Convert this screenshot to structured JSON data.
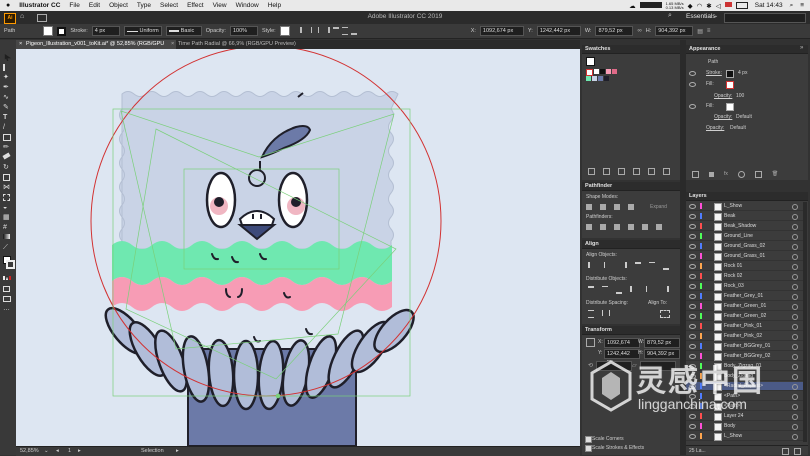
{
  "menubar": {
    "apple": "",
    "app_name": "Illustrator CC",
    "items": [
      "File",
      "Edit",
      "Object",
      "Type",
      "Select",
      "Effect",
      "View",
      "Window",
      "Help"
    ],
    "status_text": "1.65 MB/s\n0.13 MB/s",
    "clock": "Sat 14:43"
  },
  "appbar": {
    "window_title": "Adobe Illustrator CC 2019",
    "workspace": "Essentials"
  },
  "control": {
    "selection": "Path",
    "stroke_label": "Stroke:",
    "stroke_value": "4 px",
    "profile": "Uniform",
    "brush": "Basic",
    "opacity_label": "Opacity:",
    "opacity_value": "100%",
    "style_label": "Style:",
    "x_label": "X:",
    "x_value": "1092,674 px",
    "y_label": "Y:",
    "y_value": "1242,442 px",
    "w_label": "W:",
    "w_value": "879,52 px",
    "h_label": "H:",
    "h_value": "904,392 px"
  },
  "tabs": [
    {
      "label": "Pigeon_Illustration_v001_toKit.ai* @ 52,85% (RGB/GPU Preview)",
      "active": true
    },
    {
      "label": "Time Path Radial @ 66,9% (RGB/GPU Preview)",
      "active": false
    }
  ],
  "status": {
    "zoom": "52,85%",
    "page": "1",
    "mode": "Selection"
  },
  "swatches": {
    "title": "Swatches"
  },
  "appearance": {
    "title": "Appearance",
    "object": "Path",
    "rows": [
      {
        "label": "Stroke:",
        "value": "4 px"
      },
      {
        "label": "Fill:",
        "value": ""
      },
      {
        "label": "Opacity:",
        "value": "100"
      },
      {
        "label": "Fill:",
        "value": ""
      },
      {
        "label": "Opacity:",
        "value": "Default"
      },
      {
        "label": "Opacity:",
        "value": "Default"
      }
    ]
  },
  "pathfinder": {
    "title": "Pathfinder",
    "shape_modes": "Shape Modes:",
    "pathfinders": "Pathfinders:",
    "expand": "Expand"
  },
  "align": {
    "title": "Align",
    "align_objects": "Align Objects:",
    "distribute_objects": "Distribute Objects:",
    "distribute_spacing": "Distribute Spacing:",
    "align_to": "Align To:"
  },
  "transform": {
    "title": "Transform",
    "x_label": "X:",
    "x_value": "1092,674 px",
    "y_label": "Y:",
    "y_value": "1242,442 px",
    "w_label": "W:",
    "w_value": "879,52 px",
    "h_label": "H:",
    "h_value": "904,392 px",
    "scale_corners": "Scale Corners",
    "scale_strokes": "Scale Strokes & Effects"
  },
  "layers": {
    "title": "Layers",
    "rows": [
      {
        "name": "L_Show",
        "color": "#ff4fd8"
      },
      {
        "name": "Beak",
        "color": "#4f7dff"
      },
      {
        "name": "Beak_Shadow",
        "color": "#ff4f4f"
      },
      {
        "name": "Ground_Line",
        "color": "#4fff5a"
      },
      {
        "name": "Ground_Grass_02",
        "color": "#4f7dff"
      },
      {
        "name": "Ground_Grass_01",
        "color": "#ff4fd8"
      },
      {
        "name": "Rock 01",
        "color": "#ffa64f"
      },
      {
        "name": "Rock 02",
        "color": "#ff4f4f"
      },
      {
        "name": "Rock_03",
        "color": "#4fff5a"
      },
      {
        "name": "Feather_Grey_01",
        "color": "#4f7dff"
      },
      {
        "name": "Feather_Green_01",
        "color": "#ff4fd8"
      },
      {
        "name": "Feather_Green_02",
        "color": "#4fff5a"
      },
      {
        "name": "Feather_Pink_01",
        "color": "#ff4f4f"
      },
      {
        "name": "Feather_Pink_02",
        "color": "#ffa64f"
      },
      {
        "name": "Feather_BGGrey_01",
        "color": "#4f7dff"
      },
      {
        "name": "Feather_BGGrey_02",
        "color": "#ff4fd8"
      },
      {
        "name": "Body_Zigzag_01",
        "color": "#4fff5a"
      },
      {
        "name": "Body_Zigzag",
        "color": "#ffa64f"
      },
      {
        "name": "<Radial_Repeat>",
        "color": "#4f7dff"
      },
      {
        "name": "<Path>",
        "color": "#4f7dff"
      },
      {
        "name": "<Path>",
        "color": "#4f7dff"
      },
      {
        "name": "Layer 24",
        "color": "#ff4f4f"
      },
      {
        "name": "Body",
        "color": "#ff4fd8"
      },
      {
        "name": "L_Show",
        "color": "#ffa64f"
      }
    ],
    "footer": "25 La..."
  },
  "watermark": {
    "cn": "灵感中国",
    "url": "lingganchina.com"
  },
  "colors": {
    "canvas": "#dde6f2",
    "mint": "#6fe8b0",
    "pink": "#f79cb5",
    "slate": "#c9d3e6",
    "body": "#6c7aa8",
    "feather": "#b1bdd9",
    "selection": "#7ad07a",
    "circle": "#d23232"
  }
}
